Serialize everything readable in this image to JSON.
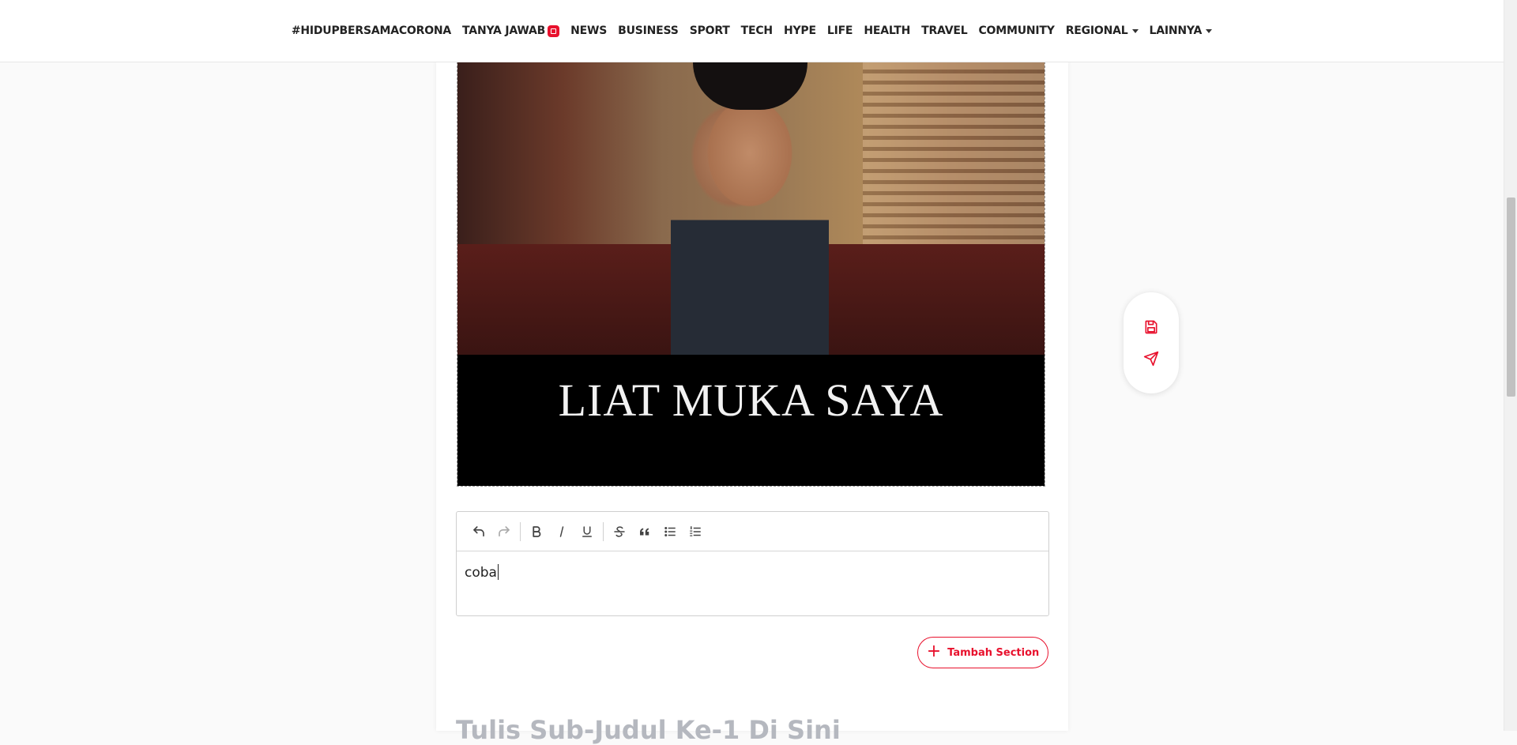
{
  "nav": {
    "items": [
      {
        "label": "#HIDUPBERSAMACORONA"
      },
      {
        "label": "TANYA JAWAB"
      },
      {
        "label": "NEWS"
      },
      {
        "label": "BUSINESS"
      },
      {
        "label": "SPORT"
      },
      {
        "label": "TECH"
      },
      {
        "label": "HYPE"
      },
      {
        "label": "LIFE"
      },
      {
        "label": "HEALTH"
      },
      {
        "label": "TRAVEL"
      },
      {
        "label": "COMMUNITY"
      },
      {
        "label": "REGIONAL"
      },
      {
        "label": "LAINNYA"
      }
    ]
  },
  "image": {
    "caption": "LIAT MUKA SAYA"
  },
  "editor": {
    "content": "coba",
    "toolbar": [
      "undo-icon",
      "redo-icon",
      "bold-icon",
      "italic-icon",
      "underline-icon",
      "strikethrough-icon",
      "blockquote-icon",
      "bulleted-list-icon",
      "numbered-list-icon"
    ]
  },
  "actions": {
    "add_section_label": "Tambah Section"
  },
  "subheading": {
    "placeholder": "Tulis Sub-Judul Ke-1 Di Sini"
  },
  "colors": {
    "accent": "#e8112d"
  }
}
